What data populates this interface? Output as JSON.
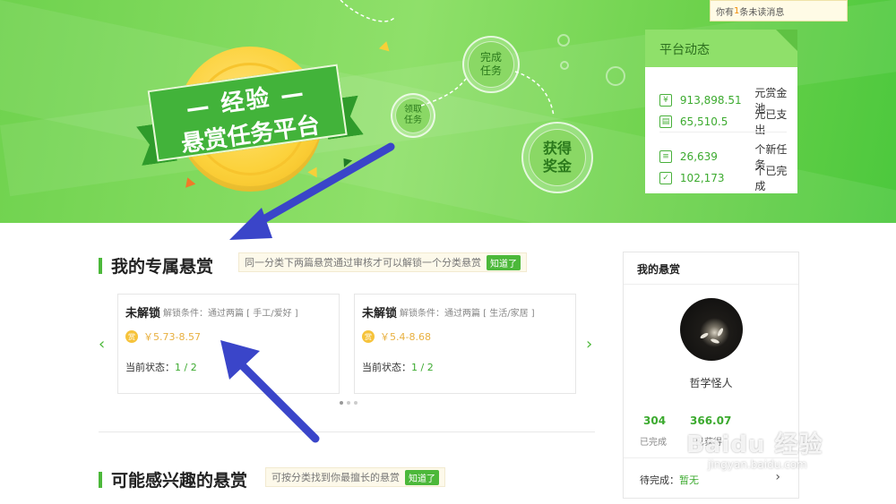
{
  "banner": {
    "ribbon_line1": "— 经验 —",
    "ribbon_line2": "悬赏任务平台",
    "steps": {
      "claim": "领取\n任务",
      "complete": "完成\n任务",
      "reward": "获得\n奖金"
    }
  },
  "notice": {
    "prefix": "你有",
    "count": "1",
    "suffix": "条未读消息"
  },
  "platform_dynamics": {
    "title": "平台动态",
    "rows": [
      {
        "icon": "yen-icon",
        "value": "913,898.51",
        "label": "元赏金池"
      },
      {
        "icon": "cash-icon",
        "value": "65,510.5",
        "label": "元已支出"
      },
      {
        "icon": "document-icon",
        "value": "26,639",
        "label": "个新任务"
      },
      {
        "icon": "checkbox-icon",
        "value": "102,173",
        "label": "个已完成"
      }
    ]
  },
  "exclusive": {
    "title": "我的专属悬赏",
    "tip": "同一分类下两篇悬赏通过审核才可以解锁一个分类悬赏",
    "tip_button": "知道了",
    "cards": [
      {
        "locked": "未解锁",
        "condition": "解锁条件：通过两篇 [ 手工/爱好 ]",
        "badge": "赏",
        "amount": "￥5.73-8.57",
        "status_label": "当前状态：",
        "status_value": "1 / 2"
      },
      {
        "locked": "未解锁",
        "condition": "解锁条件：通过两篇 [ 生活/家居 ]",
        "badge": "赏",
        "amount": "￥5.4-8.68",
        "status_label": "当前状态：",
        "status_value": "1 / 2"
      }
    ]
  },
  "interest": {
    "title": "可能感兴趣的悬赏",
    "tip": "可按分类找到你最擅长的悬赏",
    "tip_button": "知道了"
  },
  "my_bounty": {
    "title": "我的悬赏",
    "username": "哲学怪人",
    "stats": [
      {
        "value": "304",
        "label": "已完成"
      },
      {
        "value": "366.07",
        "label": "已获得"
      }
    ],
    "pending_label": "待完成：",
    "pending_value": "暂无",
    "arrow": "›"
  },
  "nav": {
    "prev": "‹",
    "next": "›"
  },
  "watermark": {
    "brand": "Baidu 经验",
    "url": "jingyan.baidu.com"
  },
  "colors": {
    "accent": "#4cb83a",
    "banner": "#7dd85a",
    "arrow": "#3a45c9",
    "amount": "#e8b040"
  }
}
